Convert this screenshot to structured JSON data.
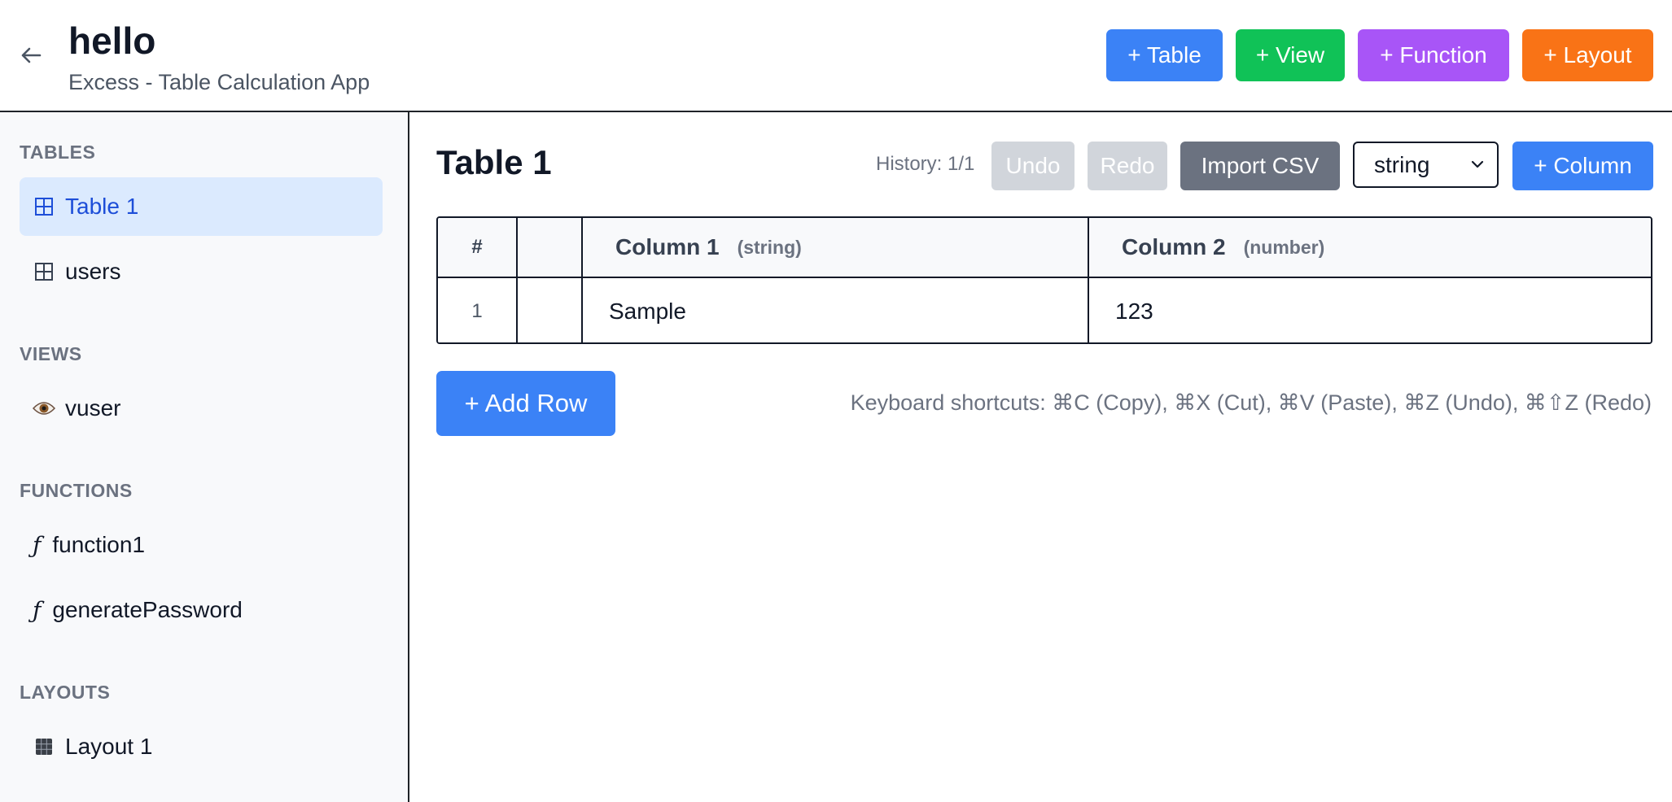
{
  "header": {
    "title": "hello",
    "subtitle": "Excess - Table Calculation App",
    "buttons": {
      "table": "+ Table",
      "view": "+ View",
      "function": "+ Function",
      "layout": "+ Layout"
    }
  },
  "sidebar": {
    "tables_heading": "TABLES",
    "tables": [
      {
        "label": "Table 1",
        "icon": "grid-icon",
        "active": true
      },
      {
        "label": "users",
        "icon": "grid-icon",
        "active": false
      }
    ],
    "views_heading": "VIEWS",
    "views": [
      {
        "label": "vuser",
        "icon": "eye-icon"
      }
    ],
    "functions_heading": "FUNCTIONS",
    "functions": [
      {
        "label": "function1",
        "icon": "function-icon",
        "glyph": "ƒ"
      },
      {
        "label": "generatePassword",
        "icon": "function-icon",
        "glyph": "ƒ"
      }
    ],
    "layouts_heading": "LAYOUTS",
    "layouts": [
      {
        "label": "Layout 1",
        "icon": "layout-icon"
      }
    ]
  },
  "main": {
    "title": "Table 1",
    "history": "History: 1/1",
    "toolbar": {
      "undo": "Undo",
      "redo": "Redo",
      "import_csv": "Import CSV",
      "type_select_value": "string",
      "add_column": "+ Column"
    },
    "table": {
      "hash_header": "#",
      "columns": [
        {
          "name": "Column 1",
          "type": "(string)"
        },
        {
          "name": "Column 2",
          "type": "(number)"
        }
      ],
      "rows": [
        {
          "num": "1",
          "cells": [
            "Sample",
            "123"
          ]
        }
      ]
    },
    "add_row": "+ Add Row",
    "shortcuts": "Keyboard shortcuts: ⌘C (Copy), ⌘X (Cut), ⌘V (Paste), ⌘Z (Undo), ⌘⇧Z (Redo)"
  },
  "colors": {
    "primary": "#3b82f6",
    "view_green": "#10c257",
    "function_purple": "#a855f7",
    "layout_orange": "#f97316",
    "import_gray": "#6b7280",
    "disabled_gray": "#d1d5db",
    "active_bg": "#dbeafe"
  }
}
